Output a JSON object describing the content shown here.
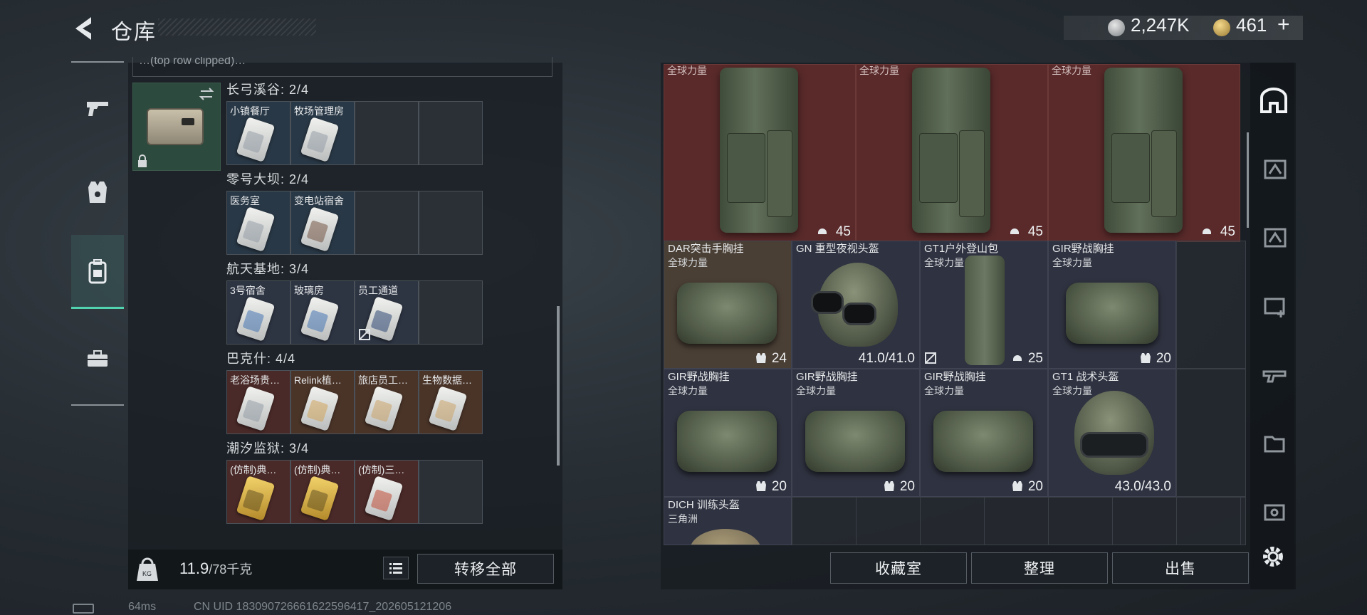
{
  "header": {
    "title": "仓库",
    "silver": "2,247K",
    "gold": "461",
    "gold_add": "+"
  },
  "left": {
    "cut_row": "…(top row clipped)…",
    "groups": [
      {
        "title": "长弓溪谷: 2/4",
        "slots": [
          "小镇餐厅",
          "牧场管理房"
        ]
      },
      {
        "title": "零号大坝: 2/4",
        "slots": [
          "医务室",
          "变电站宿舍"
        ]
      },
      {
        "title": "航天基地: 3/4",
        "slots": [
          "3号宿舍",
          "玻璃房",
          "员工通道"
        ]
      },
      {
        "title": "巴克什: 4/4",
        "slots": [
          "老浴场贵…",
          "Relink植…",
          "旅店员工…",
          "生物数据…"
        ]
      },
      {
        "title": "潮汐监狱: 3/4",
        "slots": [
          "(仿制)典…",
          "(仿制)典…",
          "(仿制)三…"
        ]
      }
    ],
    "weight_value": "11.9",
    "weight_max": "/78千克",
    "transfer_all": "转移全部"
  },
  "right": {
    "top_items": [
      {
        "tag": "全球力量",
        "value": "45"
      },
      {
        "tag": "全球力量",
        "value": "45"
      },
      {
        "tag": "全球力量",
        "value": "45"
      }
    ],
    "row2": [
      {
        "name": "DAR突击手胸挂",
        "sub": "全球力量",
        "value": "24"
      },
      {
        "name": "GN 重型夜视头盔",
        "sub": "",
        "value": "41.0/41.0"
      },
      {
        "name": "GT1户外登山包",
        "sub": "全球力量",
        "value": "25"
      },
      {
        "name": "GIR野战胸挂",
        "sub": "全球力量",
        "value": "20"
      }
    ],
    "row3": [
      {
        "name": "GIR野战胸挂",
        "sub": "全球力量",
        "value": "20"
      },
      {
        "name": "GIR野战胸挂",
        "sub": "全球力量",
        "value": "20"
      },
      {
        "name": "GIR野战胸挂",
        "sub": "全球力量",
        "value": "20"
      },
      {
        "name": "GT1 战术头盔",
        "sub": "全球力量",
        "value": "43.0/43.0"
      }
    ],
    "row4": [
      {
        "name": "DICH 训练头盔",
        "sub": "三角洲"
      }
    ],
    "buttons": {
      "collection": "收藏室",
      "sort": "整理",
      "sell": "出售"
    }
  },
  "status": {
    "ping": "64ms",
    "uid": "CN UID 18309072666162259641​7_202605121206"
  }
}
